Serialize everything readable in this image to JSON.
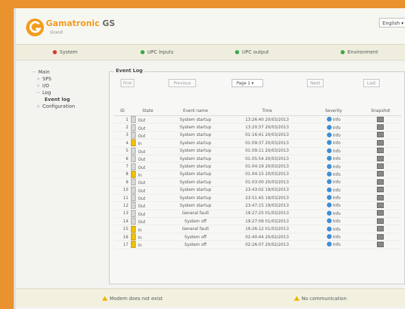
{
  "header": {
    "brand_name": "Gamatronic",
    "brand_suffix": "GS",
    "subtitle": "Grand",
    "language": "English ▾"
  },
  "status": {
    "system": "System",
    "upc_inputs": "UPC inputs",
    "upc_output": "UPC output",
    "environment": "Environment"
  },
  "sidebar": {
    "items": [
      "Main",
      "SPS",
      "I/O",
      "Log",
      "Event log",
      "Configuration"
    ]
  },
  "event_log": {
    "title": "Event Log",
    "first_label": "First",
    "previous_label": "Previous",
    "page_label": "Page 1 ▾",
    "next_label": "Next",
    "last_label": "Last",
    "columns": [
      "ID",
      "State",
      "Event name",
      "Time",
      "Severity",
      "Snapshot"
    ],
    "rows": [
      {
        "id": "1",
        "state": "Out",
        "event": "System startup",
        "time": "13:26:40 20/03/2013",
        "severity": "Info",
        "door": "closed"
      },
      {
        "id": "2",
        "state": "Out",
        "event": "System startup",
        "time": "13:20:37 20/03/2013",
        "severity": "Info",
        "door": "closed"
      },
      {
        "id": "3",
        "state": "Out",
        "event": "System startup",
        "time": "01:16:41 20/03/2013",
        "severity": "Info",
        "door": "closed"
      },
      {
        "id": "4",
        "state": "In",
        "event": "System startup",
        "time": "01:09:37 20/03/2013",
        "severity": "Info",
        "door": "open"
      },
      {
        "id": "5",
        "state": "Out",
        "event": "System startup",
        "time": "01:09:11 20/03/2013",
        "severity": "Info",
        "door": "closed"
      },
      {
        "id": "6",
        "state": "Out",
        "event": "System startup",
        "time": "01:05:54 20/03/2013",
        "severity": "Info",
        "door": "closed"
      },
      {
        "id": "7",
        "state": "Out",
        "event": "System startup",
        "time": "01:04:19 20/03/2013",
        "severity": "Info",
        "door": "closed"
      },
      {
        "id": "8",
        "state": "In",
        "event": "System startup",
        "time": "01:04:15 20/03/2013",
        "severity": "Info",
        "door": "open"
      },
      {
        "id": "9",
        "state": "Out",
        "event": "System startup",
        "time": "01:03:00 20/03/2013",
        "severity": "Info",
        "door": "closed"
      },
      {
        "id": "10",
        "state": "Out",
        "event": "System startup",
        "time": "23:43:02 19/03/2013",
        "severity": "Info",
        "door": "closed"
      },
      {
        "id": "11",
        "state": "Out",
        "event": "System startup",
        "time": "23:51:45 19/03/2013",
        "severity": "Info",
        "door": "closed"
      },
      {
        "id": "12",
        "state": "Out",
        "event": "System startup",
        "time": "23:47:15 19/03/2013",
        "severity": "Info",
        "door": "closed"
      },
      {
        "id": "13",
        "state": "Out",
        "event": "General fault",
        "time": "19:27:25 01/03/2013",
        "severity": "Info",
        "door": "closed"
      },
      {
        "id": "14",
        "state": "Out",
        "event": "System off",
        "time": "19:27:09 01/03/2013",
        "severity": "Info",
        "door": "closed"
      },
      {
        "id": "15",
        "state": "In",
        "event": "General fault",
        "time": "19:26:12 01/03/2013",
        "severity": "Info",
        "door": "open"
      },
      {
        "id": "16",
        "state": "In",
        "event": "System off",
        "time": "02:40:44 20/02/2013",
        "severity": "Info",
        "door": "open"
      },
      {
        "id": "17",
        "state": "In",
        "event": "System off",
        "time": "02:26:07 20/02/2013",
        "severity": "Info",
        "door": "open"
      }
    ]
  },
  "footer": {
    "modem": "Modem does not exist",
    "comm": "No communication"
  }
}
